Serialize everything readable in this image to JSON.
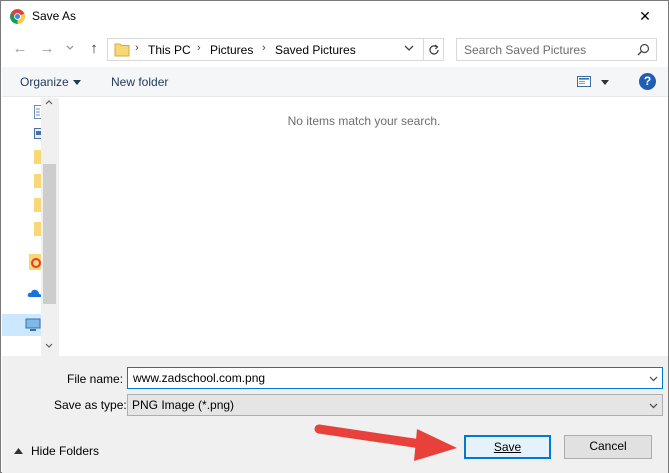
{
  "window": {
    "title": "Save As",
    "close_glyph": "✕"
  },
  "nav": {
    "back_glyph": "←",
    "forward_glyph": "→",
    "up_glyph": "↑",
    "breadcrumbs": [
      "This PC",
      "Pictures",
      "Saved Pictures"
    ],
    "search_placeholder": "Search Saved Pictures"
  },
  "toolbar": {
    "organize_label": "Organize",
    "new_folder_label": "New folder",
    "help_glyph": "?"
  },
  "content": {
    "empty_message": "No items match your search."
  },
  "form": {
    "file_name_label": "File name:",
    "file_name_value": "www.zadschool.com.png",
    "save_as_type_label": "Save as type:",
    "save_as_type_value": "PNG Image (*.png)"
  },
  "footer": {
    "hide_folders_label": "Hide Folders",
    "save_label": "Save",
    "cancel_label": "Cancel"
  },
  "colors": {
    "accent": "#0078d7",
    "arrow": "#e8413b",
    "help": "#1e5fb4"
  },
  "icons": [
    "chrome-icon",
    "close-icon",
    "back-icon",
    "forward-icon",
    "recent-icon",
    "up-icon",
    "folder-icon",
    "refresh-icon",
    "search-icon",
    "view-icon",
    "help-icon",
    "chevron-up-icon"
  ]
}
